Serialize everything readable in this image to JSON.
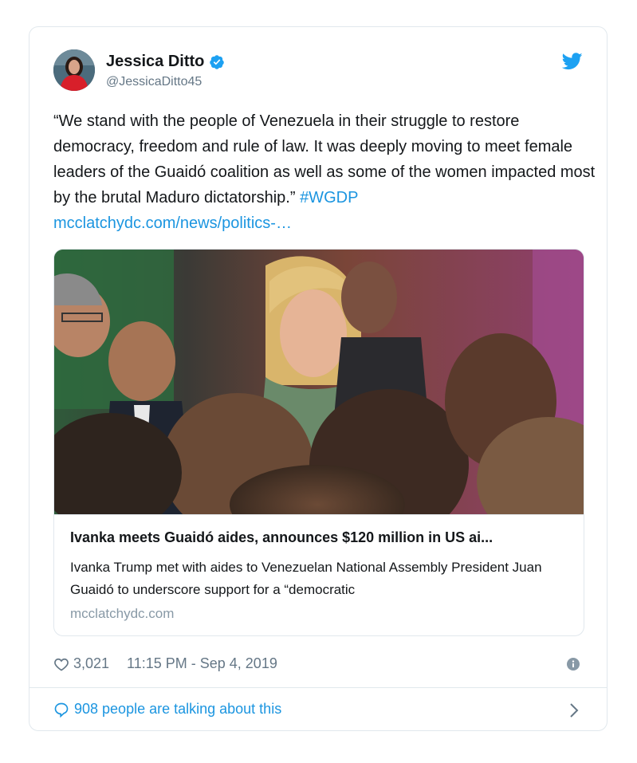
{
  "tweet": {
    "author": {
      "name": "Jessica Ditto",
      "handle": "@JessicaDitto45",
      "avatar_icon": "profile-photo",
      "verified_icon": "verified-badge-icon"
    },
    "brand_icon": "twitter-bird-icon",
    "text": "“We stand with the people of Venezuela in their struggle to restore democracy, freedom and rule of law. It was deeply moving to meet female leaders of the Guaidó coalition as well as some of the women impacted most by the brutal Maduro dictatorship.”",
    "hashtag": "#WGDP",
    "link": "mcclatchydc.com/news/politics-…",
    "card": {
      "title": "Ivanka meets Guaidó aides, announces $120 million in US ai...",
      "description": "Ivanka Trump met with aides to Venezuelan National Assembly President Juan Guaidó to underscore support for a “democratic",
      "domain": "mcclatchydc.com"
    },
    "likes": "3,021",
    "timestamp": "11:15 PM - Sep 4, 2019",
    "conversation": "908 people are talking about this"
  },
  "colors": {
    "accent": "#1b95e0",
    "text": "#14171a",
    "secondary": "#657786",
    "border": "#e1e8ed"
  }
}
